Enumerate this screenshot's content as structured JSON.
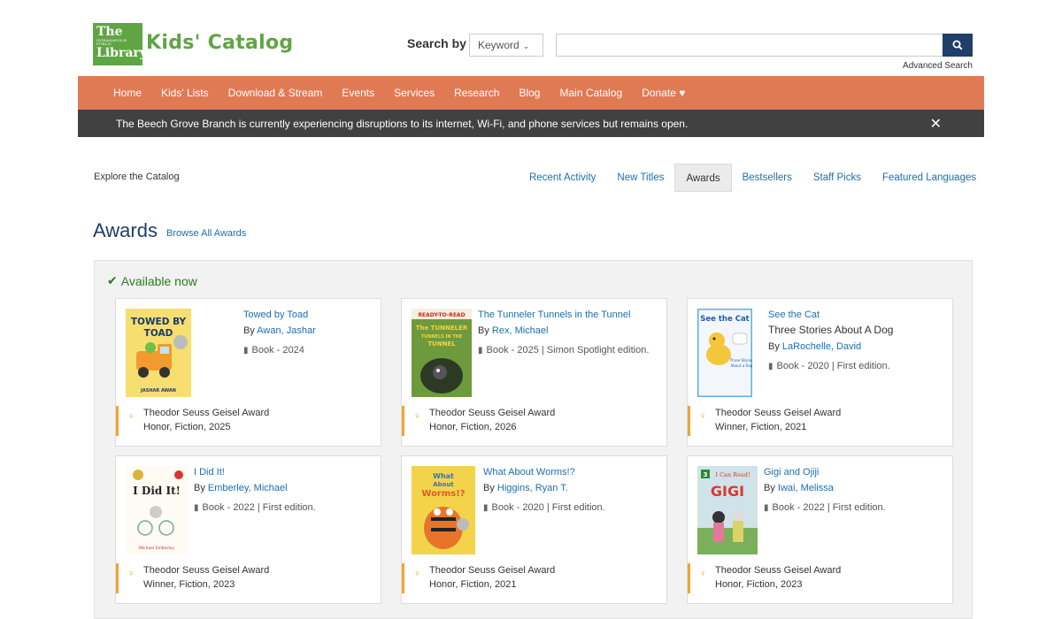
{
  "header": {
    "logo_line1": "The",
    "logo_line2": "INDIANAPOLIS PUBLIC",
    "logo_line3": "Library",
    "title": "Kids' Catalog",
    "search_label": "Search by",
    "search_type": "Keyword",
    "search_value": "",
    "advanced_search": "Advanced Search"
  },
  "nav": {
    "items": [
      "Home",
      "Kids' Lists",
      "Download & Stream",
      "Events",
      "Services",
      "Research",
      "Blog",
      "Main Catalog",
      "Donate"
    ]
  },
  "alert": {
    "text": "The Beech Grove Branch is currently experiencing disruptions to its internet, Wi-Fi, and phone services but remains open."
  },
  "explore": {
    "label": "Explore the Catalog",
    "tabs": [
      "Recent Activity",
      "New Titles",
      "Awards",
      "Bestsellers",
      "Staff Picks",
      "Featured Languages"
    ],
    "active_tab": "Awards"
  },
  "awards": {
    "title": "Awards",
    "browse_all": "Browse All Awards",
    "available_label": "Available now",
    "cards": [
      {
        "title": "Towed by Toad",
        "subtitle": "",
        "by": "By",
        "author": "Awan, Jashar",
        "format": "Book - 2024",
        "award_name": "Theodor Seuss Geisel Award",
        "award_detail": "Honor, Fiction, 2025"
      },
      {
        "title": "The Tunneler Tunnels in the Tunnel",
        "subtitle": "",
        "by": "By",
        "author": "Rex, Michael",
        "format": "Book - 2025 | Simon Spotlight edition.",
        "award_name": "Theodor Seuss Geisel Award",
        "award_detail": "Honor, Fiction, 2026"
      },
      {
        "title": "See the Cat",
        "subtitle": "Three Stories About A Dog",
        "by": "By",
        "author": "LaRochelle, David",
        "format": "Book - 2020 | First edition.",
        "award_name": "Theodor Seuss Geisel Award",
        "award_detail": "Winner, Fiction, 2021"
      },
      {
        "title": "I Did It!",
        "subtitle": "",
        "by": "By",
        "author": "Emberley, Michael",
        "format": "Book - 2022 | First edition.",
        "award_name": "Theodor Seuss Geisel Award",
        "award_detail": "Winner, Fiction, 2023"
      },
      {
        "title": "What About Worms!?",
        "subtitle": "",
        "by": "By",
        "author": "Higgins, Ryan T.",
        "format": "Book - 2020 | First edition.",
        "award_name": "Theodor Seuss Geisel Award",
        "award_detail": "Honor, Fiction, 2021"
      },
      {
        "title": "Gigi and Ojiji",
        "subtitle": "",
        "by": "By",
        "author": "Iwai, Melissa",
        "format": "Book - 2022 | First edition.",
        "award_name": "Theodor Seuss Geisel Award",
        "award_detail": "Honor, Fiction, 2023"
      }
    ]
  },
  "covers": {
    "cover1_title": "TOWED BY TOAD",
    "cover1_author": "JASHAR AWAN",
    "cover2_brand": "READY-TO-READ",
    "cover2_title": "The TUNNELER TUNNELS IN THE TUNNEL",
    "cover3_title": "See the Cat",
    "cover4_title": "I Did It!",
    "cover5_title": "What About Worms!?",
    "cover6_brand": "I Can Read!",
    "cover6_title": "GIGI"
  },
  "colors": {
    "brand_green": "#5fa544",
    "nav_orange": "#e07a55",
    "alert_dark": "#414141",
    "link_blue": "#1a6fb0",
    "award_accent": "#f0a530",
    "available_green": "#2d7a1f"
  }
}
